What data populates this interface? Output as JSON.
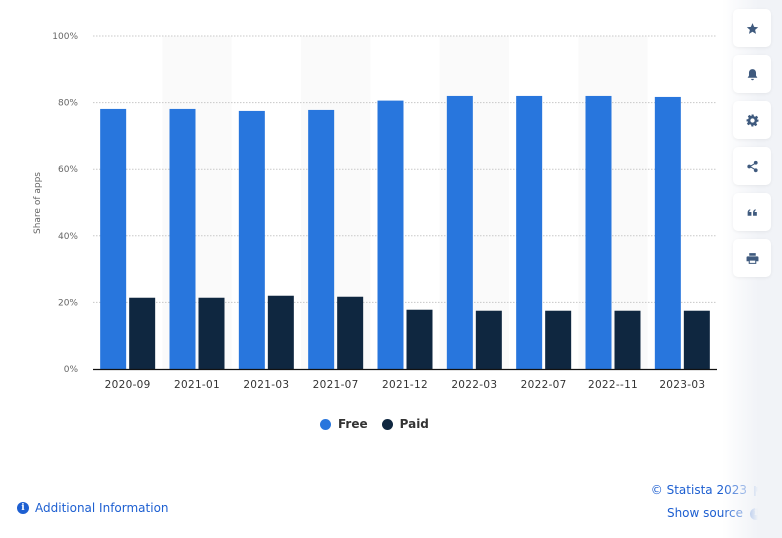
{
  "chart_data": {
    "type": "bar",
    "title": "",
    "xlabel": "",
    "ylabel": "Share of apps",
    "ylim": [
      0,
      100
    ],
    "y_ticks": [
      0,
      20,
      40,
      60,
      80,
      100
    ],
    "y_tick_labels": [
      "0%",
      "20%",
      "40%",
      "60%",
      "80%",
      "100%"
    ],
    "grid": true,
    "legend_position": "bottom-center",
    "categories": [
      "2020-09",
      "2021-01",
      "2021-03",
      "2021-07",
      "2021-12",
      "2022-03",
      "2022-07",
      "2022--11",
      "2023-03"
    ],
    "series": [
      {
        "name": "Free",
        "color": "#2876dd",
        "values": [
          78.1,
          78.1,
          77.5,
          77.8,
          80.6,
          82.0,
          82.0,
          82.0,
          81.7
        ]
      },
      {
        "name": "Paid",
        "color": "#0f2740",
        "values": [
          21.4,
          21.4,
          22.0,
          21.7,
          17.8,
          17.5,
          17.5,
          17.5,
          17.5
        ]
      }
    ]
  },
  "legend": {
    "items": [
      {
        "label": "Free",
        "color": "#2876dd"
      },
      {
        "label": "Paid",
        "color": "#0f2740"
      }
    ]
  },
  "footer": {
    "additional_info": "Additional Information",
    "copyright": "© Statista 2023",
    "show_source": "Show source"
  },
  "sidebar": {
    "buttons": [
      {
        "icon": "star-icon",
        "label": "Favorite"
      },
      {
        "icon": "bell-icon",
        "label": "Notifications"
      },
      {
        "icon": "gear-icon",
        "label": "Settings"
      },
      {
        "icon": "share-icon",
        "label": "Share"
      },
      {
        "icon": "quote-icon",
        "label": "Cite"
      },
      {
        "icon": "print-icon",
        "label": "Print"
      }
    ]
  }
}
